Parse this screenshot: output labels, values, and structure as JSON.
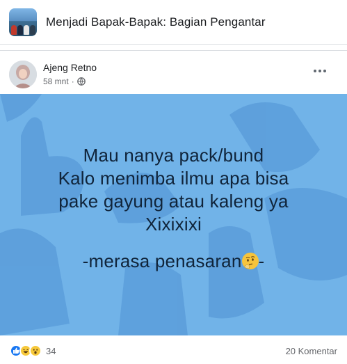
{
  "group": {
    "title": "Menjadi Bapak-Bapak: Bagian Pengantar",
    "thumbnail_icon": "group-photo"
  },
  "post": {
    "author": "Ajeng Retno",
    "time": "58 mnt",
    "privacy_icon": "globe-icon",
    "menu_icon": "more-options-icon",
    "background_color": "#71b3e8",
    "text_lines": [
      "Mau nanya pack/bund",
      "Kalo menimba ilmu apa bisa",
      "pake gayung atau kaleng ya",
      "Xixixixi"
    ],
    "signoff_prefix": "-merasa penasaran",
    "signoff_suffix": "-",
    "signoff_emoji": "thinking-face-emoji"
  },
  "footer": {
    "reaction_icons": [
      "like-reaction-icon",
      "haha-reaction-icon",
      "wow-reaction-icon"
    ],
    "reaction_count": "34",
    "comment_count": "20 Komentar"
  }
}
